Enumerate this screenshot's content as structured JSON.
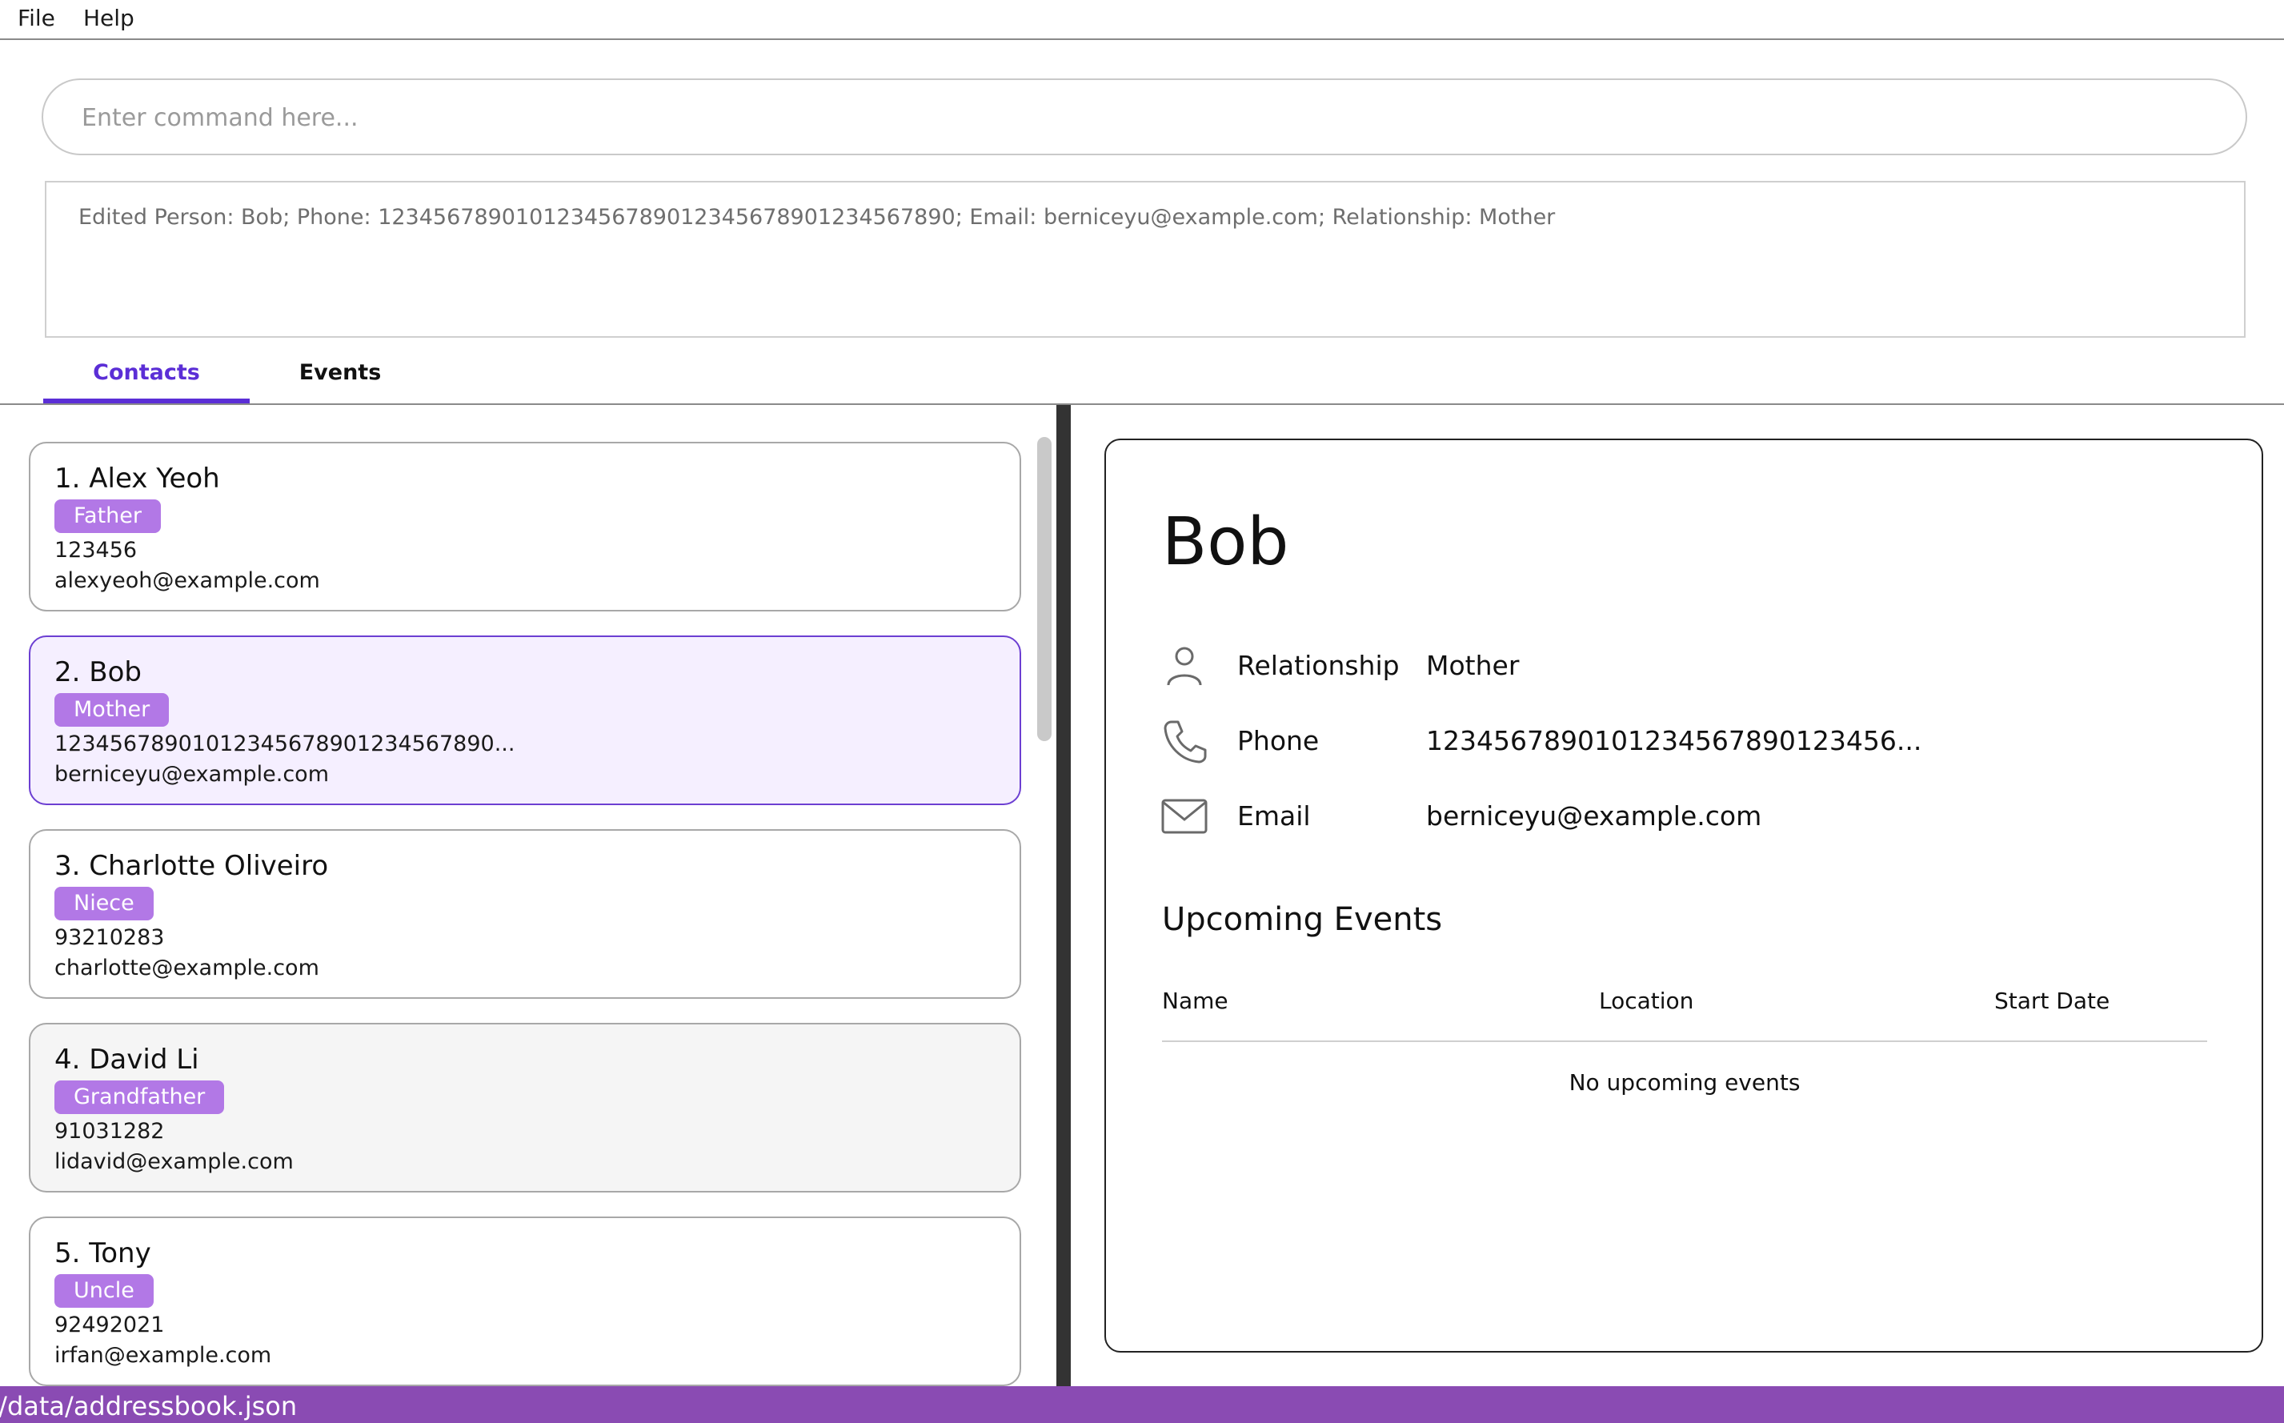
{
  "menu": {
    "file": "File",
    "help": "Help"
  },
  "command": {
    "placeholder": "Enter command here..."
  },
  "result": {
    "text": "Edited Person: Bob; Phone: 1234567890101234567890123456789012345678​90; Email: berniceyu@example.com; Relationship: Mother"
  },
  "tabs": {
    "contacts": "Contacts",
    "events": "Events",
    "active": "Contacts"
  },
  "contacts": [
    {
      "index_name": "1. Alex Yeoh",
      "tag": "Father",
      "phone": "123456",
      "email": "alexyeoh@example.com"
    },
    {
      "index_name": "2. Bob",
      "tag": "Mother",
      "phone": "123456789010123456789012345678​90...",
      "email": "berniceyu@example.com"
    },
    {
      "index_name": "3. Charlotte Oliveiro",
      "tag": "Niece",
      "phone": "93210283",
      "email": "charlotte@example.com"
    },
    {
      "index_name": "4. David Li",
      "tag": "Grandfather",
      "phone": "91031282",
      "email": "lidavid@example.com"
    },
    {
      "index_name": "5. Tony",
      "tag": "Uncle",
      "phone": "92492021",
      "email": "irfan@example.com"
    }
  ],
  "detail": {
    "name": "Bob",
    "relationship_label": "Relationship",
    "relationship_value": "Mother",
    "phone_label": "Phone",
    "phone_value": "123456789010123456789012345​6...",
    "email_label": "Email",
    "email_value": "berniceyu@example.com",
    "upcoming_title": "Upcoming Events",
    "col_name": "Name",
    "col_location": "Location",
    "col_start": "Start Date",
    "empty": "No upcoming events"
  },
  "status": {
    "path": "./data/addressbook.json"
  },
  "colors": {
    "accent": "#5b2ed6",
    "badge": "#b278e6",
    "status": "#8a4bb3",
    "selected_bg": "#f5efff"
  }
}
